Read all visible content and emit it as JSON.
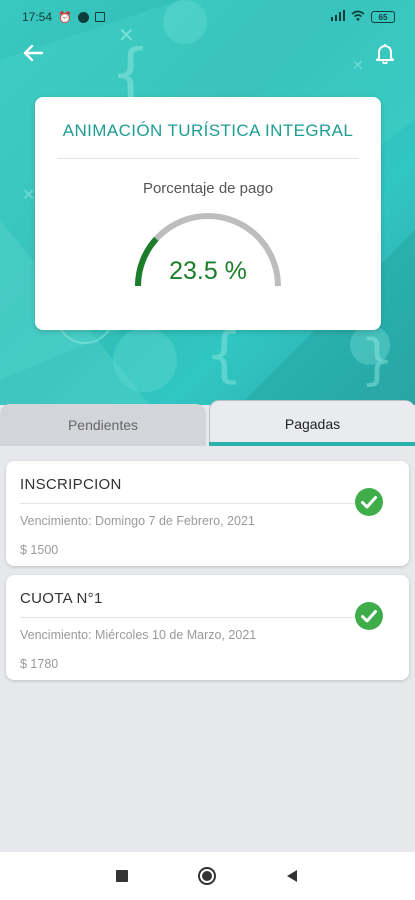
{
  "status_bar": {
    "time": "17:54",
    "battery": "65"
  },
  "colors": {
    "accent": "#2bb2ac",
    "title_teal": "#1e9e93",
    "gauge_green": "#1c7d2b",
    "check_green": "#3fae4a"
  },
  "header": {
    "back_icon": "arrow-left-icon",
    "bell_icon": "bell-icon"
  },
  "summary": {
    "title": "ANIMACIÓN TURÍSTICA INTEGRAL",
    "subtitle": "Porcentaje de pago",
    "percent_label": "23.5 %",
    "percent_value": 23.5
  },
  "tabs": [
    {
      "label": "Pendientes",
      "active": false
    },
    {
      "label": "Pagadas",
      "active": true
    }
  ],
  "payments": [
    {
      "title": "INSCRIPCION",
      "due": "Vencimiento: Domingo 7 de Febrero, 2021",
      "amount": "$ 1500",
      "status_icon": "check-circle-icon"
    },
    {
      "title": "CUOTA N°1",
      "due": "Vencimiento: Miércoles 10 de Marzo, 2021",
      "amount": "$ 1780",
      "status_icon": "check-circle-icon"
    }
  ],
  "navbar": {
    "recent_icon": "square-icon",
    "home_icon": "circle-icon",
    "back_icon": "triangle-back-icon"
  }
}
